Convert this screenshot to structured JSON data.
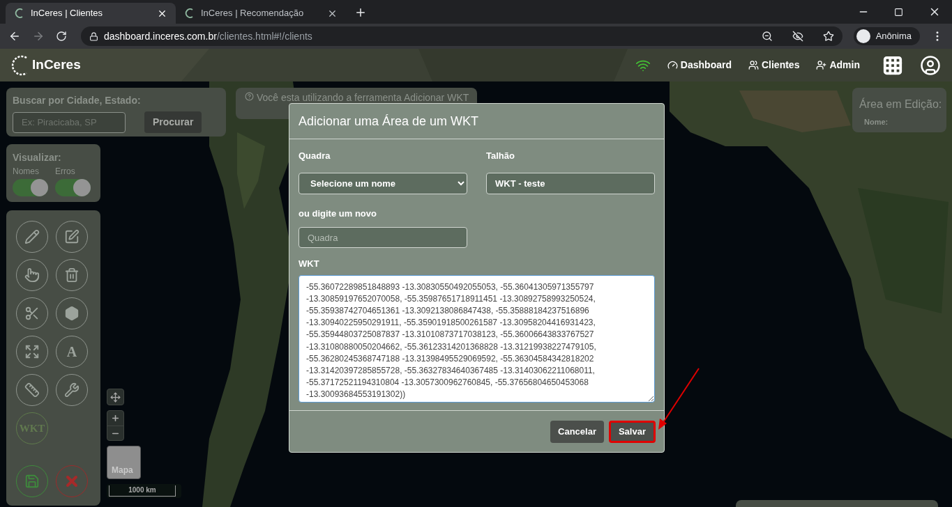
{
  "browser": {
    "tabs": [
      {
        "title": "InCeres | Clientes",
        "selected": true
      },
      {
        "title": "InCeres | Recomendação",
        "selected": false
      }
    ],
    "url": {
      "host": "dashboard.inceres.com.br",
      "path": "/clientes.html#!/clients"
    },
    "profile": "Anônima"
  },
  "navbar": {
    "logo": "InCeres",
    "links": [
      {
        "kind": "dashboard",
        "label": "Dashboard"
      },
      {
        "kind": "clients",
        "label": "Clientes"
      },
      {
        "kind": "admin",
        "label": "Admin"
      }
    ]
  },
  "search": {
    "label": "Buscar por Cidade, Estado:",
    "placeholder": "Ex: Piracicaba, SP",
    "button": "Procurar"
  },
  "visualize": {
    "title": "Visualizar:",
    "toggles": [
      {
        "label": "Nomes",
        "on": true
      },
      {
        "label": "Erros",
        "on": true
      }
    ]
  },
  "tools": [
    {
      "kind": "pencil",
      "selected": false
    },
    {
      "kind": "edit",
      "selected": false
    },
    {
      "kind": "hand",
      "selected": false
    },
    {
      "kind": "trash",
      "selected": false
    },
    {
      "kind": "cut",
      "selected": false
    },
    {
      "kind": "polygon",
      "selected": false
    },
    {
      "kind": "fit",
      "selected": false
    },
    {
      "kind": "text",
      "label": "A",
      "selected": false
    },
    {
      "kind": "ruler",
      "selected": false
    },
    {
      "kind": "wrench",
      "selected": false
    },
    {
      "kind": "text",
      "label": "WKT",
      "selected": true
    }
  ],
  "actions": [
    {
      "kind": "save"
    },
    {
      "kind": "cancel"
    }
  ],
  "map": {
    "layer": "Mapa",
    "scale": "1000 km"
  },
  "notice": "Você esta utilizando a ferramenta Adicionar WKT",
  "edit_panel": {
    "title": "Área em Edição:",
    "fields": [
      "Nome:"
    ]
  },
  "modal": {
    "title": "Adicionar uma Área de um WKT",
    "quadra": {
      "label": "Quadra",
      "value": "Selecione um nome"
    },
    "talhao": {
      "label": "Talhão",
      "value": "WKT - teste"
    },
    "new_quadra": {
      "label": "ou digite um novo",
      "placeholder": "Quadra"
    },
    "wkt": {
      "label": "WKT",
      "value": "-55.36072289851848893 -13.30830550492055053, -55.36041305971355797\n-13.30859197652070058, -55.35987651718911451 -13.30892758993250524,\n-55.35938742704651361 -13.3092138086847438, -55.35888184237516896\n-13.30940225950291911, -55.35901918500261587 -13.30958204416931423,\n-55.35944803725087837 -13.31010873717038123, -55.36006643833767527\n-13.31080880050204662, -55.36123314201368828 -13.31219938227479105,\n-55.36280245368747188 -13.31398495529069592, -55.36304584342818202\n-13.31420397285855728, -55.36327834640367485 -13.31403062211068011,\n-55.37172521194310804 -13.3057300962760845, -55.37656804650453068\n-13.30093684553191302))"
    },
    "buttons": [
      {
        "label": "Cancelar",
        "highlighted": false
      },
      {
        "label": "Salvar",
        "highlighted": true
      }
    ]
  }
}
